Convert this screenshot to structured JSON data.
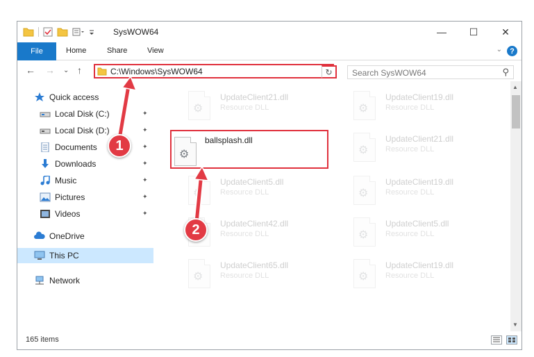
{
  "window": {
    "title": "SysWOW64",
    "minimize_glyph": "—",
    "maximize_glyph": "☐",
    "close_glyph": "✕"
  },
  "ribbon": {
    "tabs": [
      {
        "label": "File"
      },
      {
        "label": "Home"
      },
      {
        "label": "Share"
      },
      {
        "label": "View"
      }
    ],
    "help_glyph": "?",
    "collapse_glyph": "⌄"
  },
  "navigation": {
    "back_glyph": "←",
    "forward_glyph": "→",
    "recent_glyph": "⌄",
    "up_glyph": "↑",
    "address_path": "C:\\Windows\\SysWOW64",
    "address_dropdown_glyph": "⌄",
    "refresh_glyph": "↻",
    "search_placeholder": "Search SysWOW64",
    "search_glyph": "⚲"
  },
  "sidebar": {
    "items": [
      {
        "label": "Quick access",
        "icon": "star-icon",
        "pinned": false
      },
      {
        "label": "Local Disk (C:)",
        "icon": "drive-icon",
        "pinned": true
      },
      {
        "label": "Local Disk (D:)",
        "icon": "drive-icon",
        "pinned": true
      },
      {
        "label": "Documents",
        "icon": "documents-icon",
        "pinned": true
      },
      {
        "label": "Downloads",
        "icon": "downloads-icon",
        "pinned": true
      },
      {
        "label": "Music",
        "icon": "music-icon",
        "pinned": true
      },
      {
        "label": "Pictures",
        "icon": "pictures-icon",
        "pinned": true
      },
      {
        "label": "Videos",
        "icon": "videos-icon",
        "pinned": true
      },
      {
        "label": "OneDrive",
        "icon": "cloud-icon",
        "pinned": false
      },
      {
        "label": "This PC",
        "icon": "computer-icon",
        "pinned": false
      },
      {
        "label": "Network",
        "icon": "network-icon",
        "pinned": false
      }
    ],
    "pin_glyph": "📌"
  },
  "files": {
    "type_label": "Resource DLL",
    "items": [
      {
        "name": "UpdateClient21.dll",
        "type": "Resource DLL"
      },
      {
        "name": "UpdateClient19.dll",
        "type": "Resource DLL"
      },
      {
        "name": "ballsplash.dll",
        "type": ""
      },
      {
        "name": "UpdateClient21.dll",
        "type": "Resource DLL"
      },
      {
        "name": "UpdateClient5.dll",
        "type": "Resource DLL"
      },
      {
        "name": "UpdateClient19.dll",
        "type": "Resource DLL"
      },
      {
        "name": "UpdateClient42.dll",
        "type": "Resource DLL"
      },
      {
        "name": "UpdateClient5.dll",
        "type": "Resource DLL"
      },
      {
        "name": "UpdateClient65.dll",
        "type": "Resource DLL"
      },
      {
        "name": "UpdateClient19.dll",
        "type": "Resource DLL"
      }
    ]
  },
  "status": {
    "item_count": "165 items"
  },
  "annotations": {
    "step1": "1",
    "step2": "2",
    "color": "#e23a44"
  },
  "colors": {
    "accent": "#1979ca",
    "highlight_red": "#e0303c",
    "selected_bg": "#cce8ff"
  }
}
